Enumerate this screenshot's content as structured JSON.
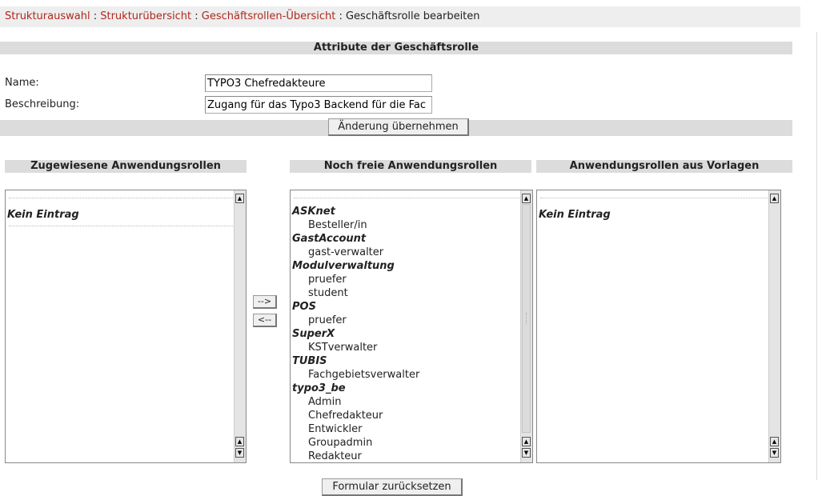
{
  "breadcrumb": {
    "items": [
      "Strukturauswahl",
      "Strukturübersicht",
      "Geschäftsrollen-Übersicht"
    ],
    "separator": " : ",
    "current": "Geschäftsrolle bearbeiten"
  },
  "attributes": {
    "title": "Attribute der Geschäftsrolle",
    "name_label": "Name:",
    "name_value": "TYPO3 Chefredakteure",
    "description_label": "Beschreibung:",
    "description_value": "Zugang für das Typo3 Backend für die Fac",
    "apply_button": "Änderung übernehmen"
  },
  "assigned": {
    "title": "Zugewiesene Anwendungsrollen",
    "empty_text": "Kein Eintrag"
  },
  "transfer": {
    "add_label": "-->",
    "remove_label": "<--"
  },
  "available": {
    "title": "Noch freie Anwendungsrollen",
    "groups": [
      {
        "name": "ASKnet",
        "items": [
          "Besteller/in"
        ]
      },
      {
        "name": "GastAccount",
        "items": [
          "gast-verwalter"
        ]
      },
      {
        "name": "Modulverwaltung",
        "items": [
          "pruefer",
          "student"
        ]
      },
      {
        "name": "POS",
        "items": [
          "pruefer"
        ]
      },
      {
        "name": "SuperX",
        "items": [
          "KSTverwalter"
        ]
      },
      {
        "name": "TUBIS",
        "items": [
          "Fachgebietsverwalter"
        ]
      },
      {
        "name": "typo3_be",
        "items": [
          "Admin",
          "Chefredakteur",
          "Entwickler",
          "Groupadmin",
          "Redakteur"
        ]
      }
    ]
  },
  "templates": {
    "title": "Anwendungsrollen aus Vorlagen",
    "empty_text": "Kein Eintrag"
  },
  "reset_button": "Formular zurücksetzen",
  "colors": {
    "link": "#b0281e",
    "header_bar": "#dcdcdc",
    "breadcrumb_bar": "#eeeeee"
  },
  "icons": {
    "scroll_up": "▲",
    "scroll_down": "▼"
  }
}
